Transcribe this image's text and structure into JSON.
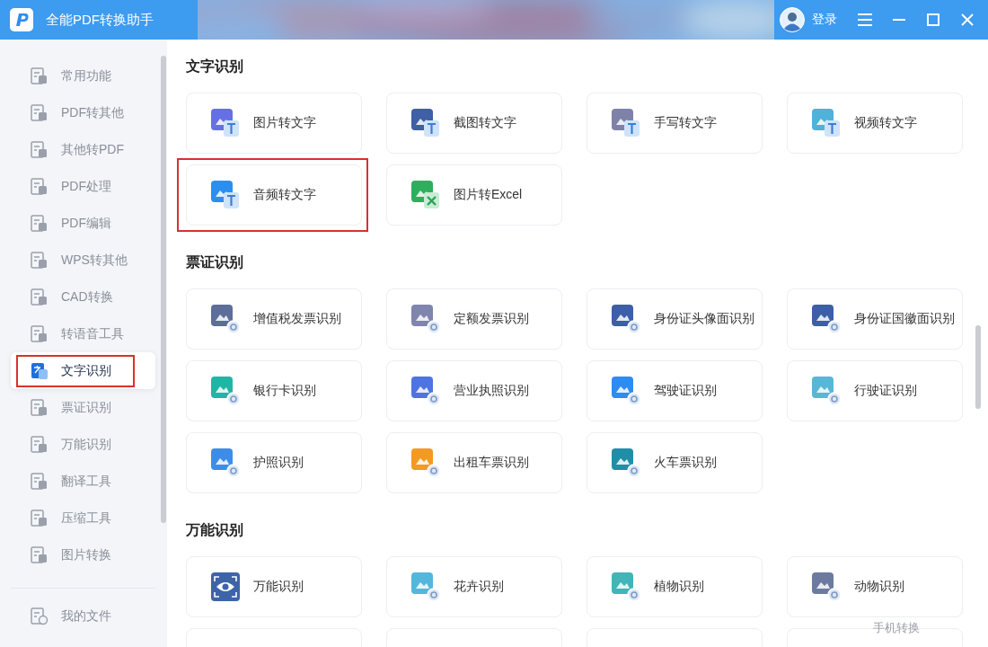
{
  "window": {
    "title": "全能PDF转换助手"
  },
  "titlebar": {
    "login": "登录"
  },
  "sidebar": {
    "items": [
      {
        "label": "常用功能",
        "selected": false,
        "highlighted": false
      },
      {
        "label": "PDF转其他",
        "selected": false,
        "highlighted": false
      },
      {
        "label": "其他转PDF",
        "selected": false,
        "highlighted": false
      },
      {
        "label": "PDF处理",
        "selected": false,
        "highlighted": false
      },
      {
        "label": "PDF编辑",
        "selected": false,
        "highlighted": false
      },
      {
        "label": "WPS转其他",
        "selected": false,
        "highlighted": false
      },
      {
        "label": "CAD转换",
        "selected": false,
        "highlighted": false
      },
      {
        "label": "转语音工具",
        "selected": false,
        "highlighted": false
      },
      {
        "label": "文字识别",
        "selected": true,
        "highlighted": true
      },
      {
        "label": "票证识别",
        "selected": false,
        "highlighted": false
      },
      {
        "label": "万能识别",
        "selected": false,
        "highlighted": false
      },
      {
        "label": "翻译工具",
        "selected": false,
        "highlighted": false
      },
      {
        "label": "压缩工具",
        "selected": false,
        "highlighted": false
      },
      {
        "label": "图片转换",
        "selected": false,
        "highlighted": false
      }
    ],
    "footer_item": {
      "label": "我的文件"
    }
  },
  "sections": [
    {
      "title": "文字识别",
      "cards": [
        {
          "label": "图片转文字",
          "kind": "text",
          "color": "#6670e6",
          "highlighted": false
        },
        {
          "label": "截图转文字",
          "kind": "text",
          "color": "#3f5fa6",
          "highlighted": false
        },
        {
          "label": "手写转文字",
          "kind": "text",
          "color": "#7f82a8",
          "highlighted": false
        },
        {
          "label": "视频转文字",
          "kind": "text",
          "color": "#4fb2d8",
          "highlighted": false
        },
        {
          "label": "音频转文字",
          "kind": "text",
          "color": "#2b8ff0",
          "highlighted": true
        },
        {
          "label": "图片转Excel",
          "kind": "excel",
          "color": "#2fae5e",
          "highlighted": false
        }
      ]
    },
    {
      "title": "票证识别",
      "cards": [
        {
          "label": "增值税发票识别",
          "kind": "camera",
          "color": "#5b6f99",
          "highlighted": false
        },
        {
          "label": "定额发票识别",
          "kind": "camera",
          "color": "#8085ad",
          "highlighted": false
        },
        {
          "label": "身份证头像面识别",
          "kind": "camera",
          "color": "#3c5fa8",
          "highlighted": false
        },
        {
          "label": "身份证国徽面识别",
          "kind": "camera",
          "color": "#3c5fa8",
          "highlighted": false
        },
        {
          "label": "银行卡识别",
          "kind": "camera",
          "color": "#21b5a6",
          "highlighted": false
        },
        {
          "label": "营业执照识别",
          "kind": "camera",
          "color": "#4d74e0",
          "highlighted": false
        },
        {
          "label": "驾驶证识别",
          "kind": "camera",
          "color": "#2d8cf0",
          "highlighted": false
        },
        {
          "label": "行驶证识别",
          "kind": "camera",
          "color": "#58b7d6",
          "highlighted": false
        },
        {
          "label": "护照识别",
          "kind": "camera",
          "color": "#3d8de8",
          "highlighted": false
        },
        {
          "label": "出租车票识别",
          "kind": "camera",
          "color": "#f39a24",
          "highlighted": false
        },
        {
          "label": "火车票识别",
          "kind": "camera",
          "color": "#1f8fa8",
          "highlighted": false
        }
      ]
    },
    {
      "title": "万能识别",
      "cards": [
        {
          "label": "万能识别",
          "kind": "eye",
          "color": "#3e64a8",
          "highlighted": false
        },
        {
          "label": "花卉识别",
          "kind": "camera",
          "color": "#55b6dc",
          "highlighted": false
        },
        {
          "label": "植物识别",
          "kind": "camera",
          "color": "#41b5b7",
          "highlighted": false
        },
        {
          "label": "动物识别",
          "kind": "camera",
          "color": "#6d7aa0",
          "highlighted": false
        },
        {
          "kind": "blank"
        },
        {
          "kind": "blank"
        },
        {
          "kind": "blank"
        },
        {
          "kind": "blank"
        }
      ]
    }
  ],
  "floating_label": "手机转换"
}
